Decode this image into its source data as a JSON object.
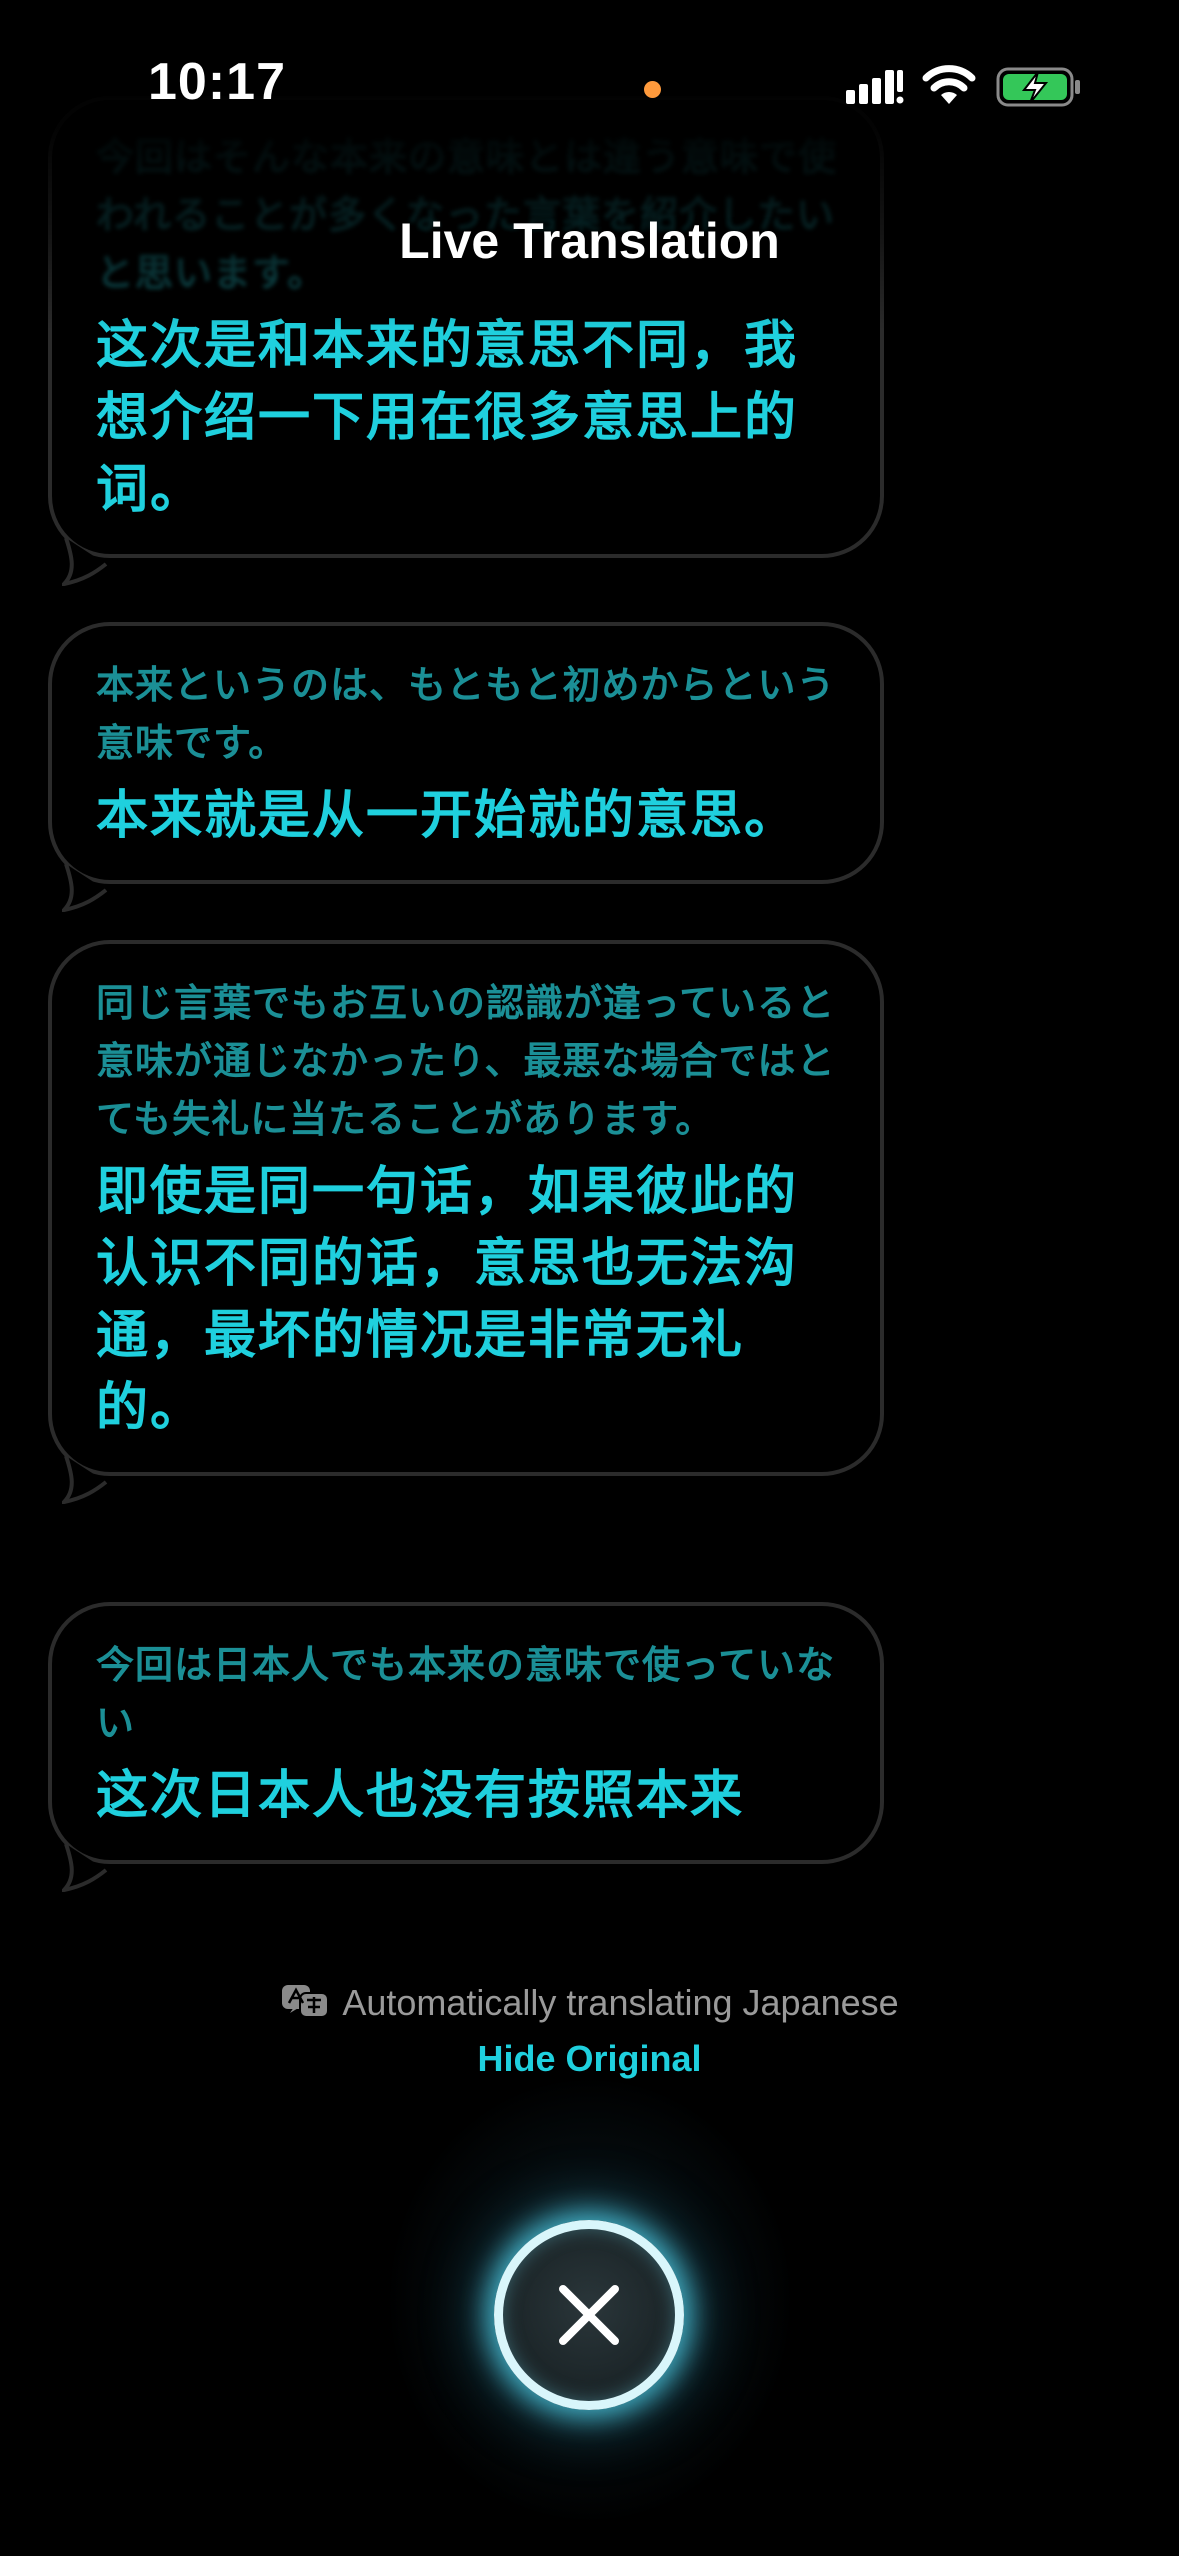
{
  "status_bar": {
    "time": "10:17"
  },
  "header": {
    "title": "Live Translation"
  },
  "bubbles": [
    {
      "original": "今回はそんな本来の意味とは違う意味で使われることが多くなった言葉を紹介したいと思います。",
      "translated": "这次是和本来的意思不同，我想介绍一下用在很多意思上的词。"
    },
    {
      "original": "本来というのは、もともと初めからという意味です。",
      "translated": "本来就是从一开始就的意思。"
    },
    {
      "original": "同じ言葉でもお互いの認識が違っていると意味が通じなかったり、最悪な場合ではとても失礼に当たることがあります。",
      "translated": "即使是同一句话，如果彼此的认识不同的话，意思也无法沟通，最坏的情况是非常无礼的。"
    },
    {
      "original": "今回は日本人でも本来の意味で使っていない",
      "translated": "这次日本人也没有按照本来"
    }
  ],
  "footer": {
    "auto_translate_label": "Automatically translating Japanese",
    "hide_original_label": "Hide Original"
  },
  "colors": {
    "accent": "#1fd0de",
    "original_text": "#1b8f96",
    "bubble_border": "#2b2b2b",
    "battery_fill": "#34c759",
    "recording_dot": "#ff9a3c"
  },
  "icons": {
    "status": [
      "cellular-signal-icon",
      "wifi-icon",
      "battery-charging-icon"
    ],
    "translate": "translate-icon",
    "close": "close-icon"
  }
}
